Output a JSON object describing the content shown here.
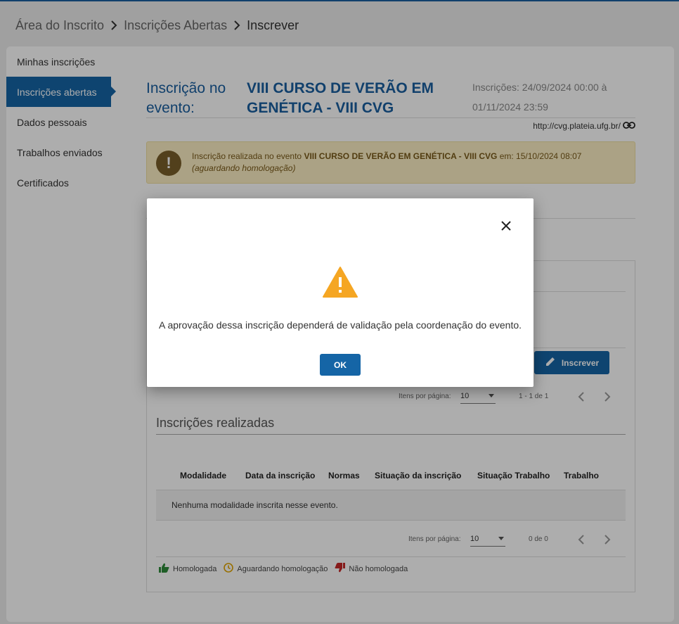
{
  "breadcrumb": {
    "items": [
      "Área do Inscrito",
      "Inscrições Abertas"
    ],
    "current": "Inscrever"
  },
  "sidebar": {
    "items": [
      {
        "label": "Minhas inscrições"
      },
      {
        "label": "Inscrições abertas"
      },
      {
        "label": "Dados pessoais"
      },
      {
        "label": "Trabalhos enviados"
      },
      {
        "label": "Certificados"
      }
    ],
    "active_index": 1
  },
  "event": {
    "label": "Inscrição no evento:",
    "name": "VIII CURSO DE VERÃO EM GENÉTICA - VIII CVG",
    "dates": "Inscrições: 24/09/2024 00:00 à 01/11/2024 23:59",
    "link": "http://cvg.plateia.ufg.br/"
  },
  "alert": {
    "prefix": "Inscrição realizada no evento",
    "event": "VIII CURSO DE VERÃO EM GENÉTICA - VIII CVG",
    "suffix": "em: 15/10/2024 08:07",
    "status": "(aguardando homologação)"
  },
  "inscrever": {
    "label": "Inscrever"
  },
  "pager_top": {
    "label": "Itens por página:",
    "value": "10",
    "range": "1 - 1 de 1"
  },
  "realizadas": {
    "title": "Inscrições realizadas",
    "columns": [
      "Modalidade",
      "Data da inscrição",
      "Normas",
      "Situação da inscrição",
      "Situação Trabalho",
      "Trabalho"
    ],
    "empty": "Nenhuma modalidade inscrita nesse evento."
  },
  "pager_bottom": {
    "label": "Itens por página:",
    "value": "10",
    "range": "0 de 0"
  },
  "legend": {
    "items": [
      {
        "label": "Homologada",
        "icon": "thumbs-up-icon",
        "color": "#2e8b3a"
      },
      {
        "label": "Aguardando homologação",
        "icon": "clock-icon",
        "color": "#e0a400"
      },
      {
        "label": "Não homologada",
        "icon": "thumbs-down-icon",
        "color": "#c62828"
      }
    ]
  },
  "modal": {
    "message": "A aprovação dessa inscrição dependerá de validação pela coordenação do evento.",
    "ok_label": "OK",
    "warning_color": "#f5a623"
  },
  "colors": {
    "primary": "#1565a6",
    "alert_bg": "#fcefc4"
  }
}
